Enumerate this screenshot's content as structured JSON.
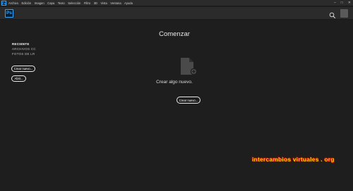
{
  "menubar": {
    "items": [
      "Archivo",
      "Edición",
      "Imagen",
      "Capa",
      "Texto",
      "Selección",
      "Filtro",
      "3D",
      "Vista",
      "Ventana",
      "Ayuda"
    ]
  },
  "app": {
    "logo_text": "Ps"
  },
  "sidebar": {
    "recent": "RECIENTE",
    "cc_files": "ARCHIVOS CC",
    "lr_photos": "FOTOS DE LR",
    "new_button": "Crear nuevo...",
    "open_button": "Abrir..."
  },
  "main": {
    "title": "Comenzar",
    "subtitle": "Crear algo nuevo.",
    "new_button": "Crear nuevo..."
  },
  "watermark": {
    "text": "intercambios virtuales . org"
  },
  "icons": {
    "search": "search-icon",
    "document": "new-document-icon",
    "minimize": "minimize-icon",
    "maximize": "maximize-icon",
    "close": "close-icon"
  },
  "colors": {
    "background": "#1e1e1e",
    "bar": "#2b2b2b",
    "ps_blue": "#31a8ff",
    "watermark": "#ffd200"
  }
}
